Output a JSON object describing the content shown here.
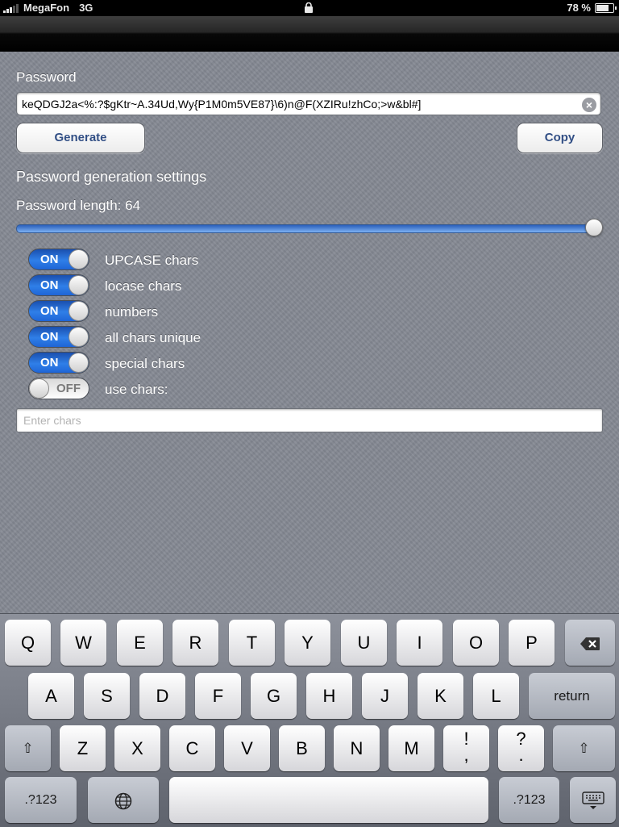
{
  "status_bar": {
    "carrier": "MegaFon",
    "network": "3G",
    "battery": "78 %",
    "battery_level": 0.78
  },
  "form": {
    "password_label": "Password",
    "password_value": "keQDGJ2a<%:?$gKtr~A.34Ud,Wy{P1M0m5VE87}\\6)n@F(XZIRu!zhCo;>w&bl#]",
    "generate_label": "Generate",
    "copy_label": "Copy",
    "settings_title": "Password generation settings",
    "length_label": "Password length: 64",
    "length_slider_fraction": 1.0,
    "chars_placeholder": "Enter chars"
  },
  "toggles": [
    {
      "state": "ON",
      "label": "UPCASE chars"
    },
    {
      "state": "ON",
      "label": "locase chars"
    },
    {
      "state": "ON",
      "label": "numbers"
    },
    {
      "state": "ON",
      "label": "all chars unique"
    },
    {
      "state": "ON",
      "label": "special chars"
    },
    {
      "state": "OFF",
      "label": "use chars:"
    }
  ],
  "keyboard": {
    "row1": [
      "Q",
      "W",
      "E",
      "R",
      "T",
      "Y",
      "U",
      "I",
      "O",
      "P"
    ],
    "row2": [
      "A",
      "S",
      "D",
      "F",
      "G",
      "H",
      "J",
      "K",
      "L"
    ],
    "return": "return",
    "row3": [
      "Z",
      "X",
      "C",
      "V",
      "B",
      "N",
      "M"
    ],
    "excl_top": "!",
    "excl_bottom": ",",
    "quest_top": "?",
    "quest_bottom": ".",
    "num_left": ".?123",
    "num_right": ".?123",
    "shift_glyph": "⇧",
    "delete_glyph": "⌫",
    "globe_glyph": "🌐",
    "hide_glyph": "⌨"
  },
  "icons": {
    "lock": "lock-icon",
    "clear": "clear-field-icon",
    "shift": "shift-icon",
    "delete": "delete-icon",
    "globe": "globe-icon",
    "hide_keyboard": "hide-keyboard-icon"
  },
  "colors": {
    "accent_blue": "#2f7fe8",
    "button_text": "#324f85",
    "background": "#858993"
  }
}
